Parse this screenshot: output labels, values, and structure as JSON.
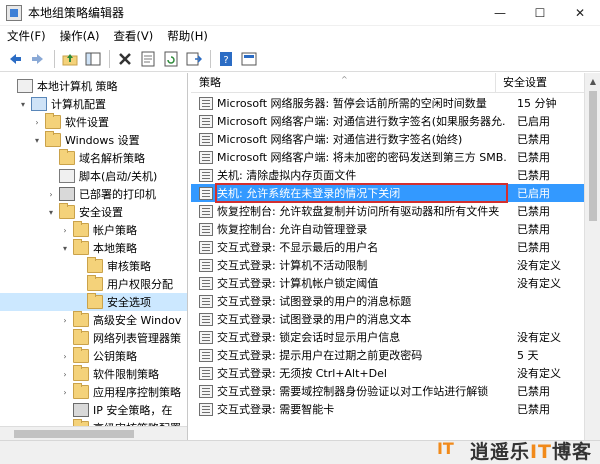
{
  "window": {
    "title": "本地组策略编辑器",
    "minimize": "—",
    "maximize": "☐",
    "close": "✕"
  },
  "menu": [
    "文件(F)",
    "操作(A)",
    "查看(V)",
    "帮助(H)"
  ],
  "tree": [
    {
      "label": "本地计算机 策略",
      "icon": "policy-icon",
      "depth": 0,
      "expander": ""
    },
    {
      "label": "计算机配置",
      "icon": "computer-icon",
      "depth": 1,
      "expander": "▾"
    },
    {
      "label": "软件设置",
      "icon": "folder-icon",
      "depth": 2,
      "expander": "›"
    },
    {
      "label": "Windows 设置",
      "icon": "folder-icon",
      "depth": 2,
      "expander": "▾"
    },
    {
      "label": "域名解析策略",
      "icon": "folder-icon",
      "depth": 3,
      "expander": ""
    },
    {
      "label": "脚本(启动/关机)",
      "icon": "policy-icon",
      "depth": 3,
      "expander": ""
    },
    {
      "label": "已部署的打印机",
      "icon": "printer-icon",
      "depth": 3,
      "expander": "›"
    },
    {
      "label": "安全设置",
      "icon": "folder-icon",
      "depth": 3,
      "expander": "▾"
    },
    {
      "label": "帐户策略",
      "icon": "folder-icon",
      "depth": 4,
      "expander": "›"
    },
    {
      "label": "本地策略",
      "icon": "folder-icon",
      "depth": 4,
      "expander": "▾"
    },
    {
      "label": "审核策略",
      "icon": "folder-icon",
      "depth": 5,
      "expander": ""
    },
    {
      "label": "用户权限分配",
      "icon": "folder-icon",
      "depth": 5,
      "expander": ""
    },
    {
      "label": "安全选项",
      "icon": "folder-icon",
      "depth": 5,
      "expander": "",
      "selected": true
    },
    {
      "label": "高级安全 Windov",
      "icon": "folder-icon",
      "depth": 4,
      "expander": "›"
    },
    {
      "label": "网络列表管理器策",
      "icon": "folder-icon",
      "depth": 4,
      "expander": ""
    },
    {
      "label": "公钥策略",
      "icon": "folder-icon",
      "depth": 4,
      "expander": "›"
    },
    {
      "label": "软件限制策略",
      "icon": "folder-icon",
      "depth": 4,
      "expander": "›"
    },
    {
      "label": "应用程序控制策略",
      "icon": "folder-icon",
      "depth": 4,
      "expander": "›"
    },
    {
      "label": "IP 安全策略，在",
      "icon": "printer-icon",
      "depth": 4,
      "expander": ""
    },
    {
      "label": "高级审核策略配置",
      "icon": "folder-icon",
      "depth": 4,
      "expander": "›"
    }
  ],
  "list": {
    "col_policy": "策略",
    "col_setting": "安全设置",
    "rows": [
      {
        "name": "Microsoft 网络服务器: 暂停会话前所需的空闲时间数量",
        "value": "15 分钟"
      },
      {
        "name": "Microsoft 网络客户端: 对通信进行数字签名(如果服务器允...",
        "value": "已启用"
      },
      {
        "name": "Microsoft 网络客户端: 对通信进行数字签名(始终)",
        "value": "已禁用"
      },
      {
        "name": "Microsoft 网络客户端: 将未加密的密码发送到第三方 SMB...",
        "value": "已禁用"
      },
      {
        "name": "关机: 清除虚拟内存页面文件",
        "value": "已禁用"
      },
      {
        "name": "关机: 允许系统在未登录的情况下关闭",
        "value": "已启用",
        "highlight": true
      },
      {
        "name": "恢复控制台: 允许软盘复制并访问所有驱动器和所有文件夹",
        "value": "已禁用"
      },
      {
        "name": "恢复控制台: 允许自动管理登录",
        "value": "已禁用"
      },
      {
        "name": "交互式登录: 不显示最后的用户名",
        "value": "已禁用"
      },
      {
        "name": "交互式登录: 计算机不活动限制",
        "value": "没有定义"
      },
      {
        "name": "交互式登录: 计算机帐户锁定阈值",
        "value": "没有定义"
      },
      {
        "name": "交互式登录: 试图登录的用户的消息标题",
        "value": ""
      },
      {
        "name": "交互式登录: 试图登录的用户的消息文本",
        "value": ""
      },
      {
        "name": "交互式登录: 锁定会话时显示用户信息",
        "value": "没有定义"
      },
      {
        "name": "交互式登录: 提示用户在过期之前更改密码",
        "value": "5 天"
      },
      {
        "name": "交互式登录: 无须按 Ctrl+Alt+Del",
        "value": "没有定义"
      },
      {
        "name": "交互式登录: 需要域控制器身份验证以对工作站进行解锁",
        "value": "已禁用"
      },
      {
        "name": "交互式登录: 需要智能卡",
        "value": "已禁用"
      }
    ]
  },
  "watermark": {
    "prefix": "逍遥乐",
    "it": "IT",
    "suffix": "博客"
  },
  "colors": {
    "selection": "#3399ff",
    "highlight_box": "#d32f2f",
    "tree_selected": "#cce8ff"
  }
}
